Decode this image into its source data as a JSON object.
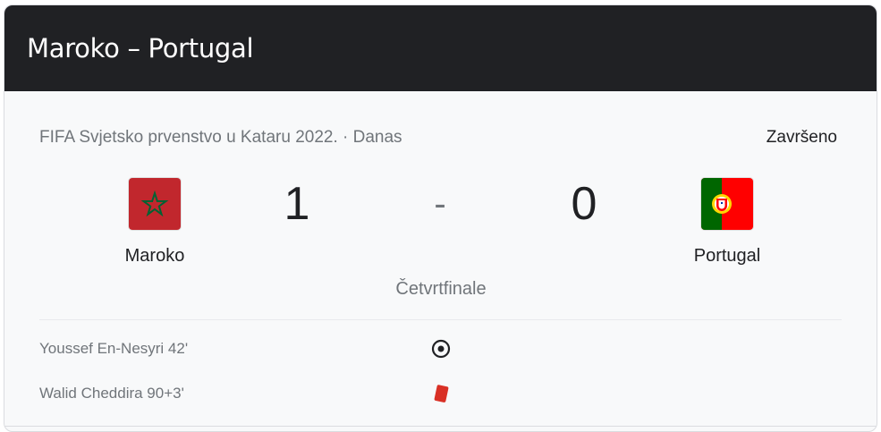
{
  "header": {
    "title": "Maroko – Portugal"
  },
  "match": {
    "competition_and_date": "FIFA Svjetsko prvenstvo u Kataru 2022. · Danas",
    "status": "Završeno",
    "round": "Četvrtfinale",
    "score_separator": "-",
    "home": {
      "name": "Maroko",
      "score": "1",
      "flag_icon": "morocco-flag-icon"
    },
    "away": {
      "name": "Portugal",
      "score": "0",
      "flag_icon": "portugal-flag-icon"
    }
  },
  "events": [
    {
      "text": "Youssef En-Nesyri 42'",
      "icon": "goal-icon"
    },
    {
      "text": "Walid Cheddira 90+3'",
      "icon": "red-card-icon"
    }
  ],
  "colors": {
    "header_bg": "#202124",
    "card_bg": "#f8f9fa",
    "red_card": "#d93025",
    "morocco_red": "#c1272d",
    "morocco_green": "#006233",
    "portugal_green": "#006600",
    "portugal_red": "#ff0000"
  }
}
